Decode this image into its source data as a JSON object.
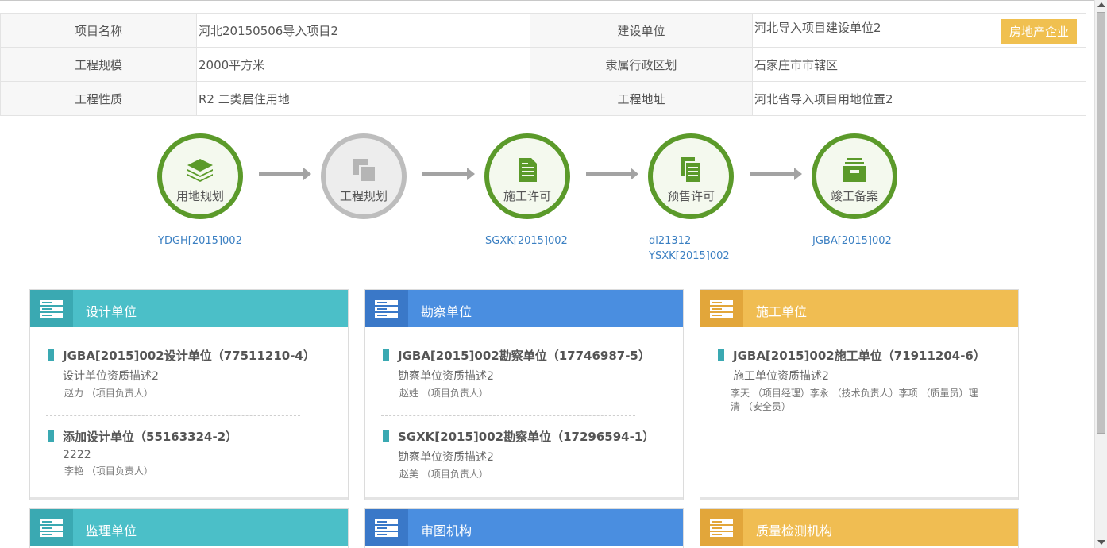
{
  "info": {
    "rows": [
      {
        "l1": "项目名称",
        "v1": "河北20150506导入项目2",
        "l2": "建设单位",
        "v2": "河北导入项目建设单位2"
      },
      {
        "l1": "工程规模",
        "v1": "2000平方米",
        "l2": "隶属行政区划",
        "v2": "石家庄市市辖区"
      },
      {
        "l1": "工程性质",
        "v1": "R2 二类居住用地",
        "l2": "工程地址",
        "v2": "河北省导入项目用地位置2"
      }
    ],
    "tag": "房地产企业"
  },
  "stages": [
    {
      "name": "用地规划",
      "icon": "layers-icon",
      "active": true,
      "codes": [
        "YDGH[2015]002"
      ]
    },
    {
      "name": "工程规划",
      "icon": "copy-icon",
      "active": false,
      "codes": []
    },
    {
      "name": "施工许可",
      "icon": "document-icon",
      "active": true,
      "codes": [
        "SGXK[2015]002"
      ]
    },
    {
      "name": "预售许可",
      "icon": "documents-icon",
      "active": true,
      "codes": [
        "dl21312",
        "YSXK[2015]002"
      ]
    },
    {
      "name": "竣工备案",
      "icon": "archive-icon",
      "active": true,
      "codes": [
        "JGBA[2015]002"
      ]
    }
  ],
  "cards": [
    {
      "title": "设计单位",
      "color": "teal",
      "entries": [
        {
          "title": "JGBA[2015]002设计单位（77511210-4）",
          "desc": "设计单位资质描述2",
          "people": "赵力 （项目负责人）"
        },
        {
          "title": "添加设计单位（55163324-2）",
          "desc": "2222",
          "people": "李艳 （项目负责人）"
        }
      ]
    },
    {
      "title": "勘察单位",
      "color": "blue",
      "entries": [
        {
          "title": "JGBA[2015]002勘察单位（17746987-5）",
          "desc": "勘察单位资质描述2",
          "people": "赵姓 （项目负责人）"
        },
        {
          "title": "SGXK[2015]002勘察单位（17296594-1）",
          "desc": "勘察单位资质描述2",
          "people": "赵美 （项目负责人）"
        }
      ]
    },
    {
      "title": "施工单位",
      "color": "yellow",
      "entries": [
        {
          "title": "JGBA[2015]002施工单位（71911204-6）",
          "desc": "施工单位资质描述2",
          "people": "李天 （项目经理）李永 （技术负责人）李项 （质量员）理清 （安全员）"
        }
      ]
    },
    {
      "title": "监理单位",
      "color": "teal",
      "entries": []
    },
    {
      "title": "审图机构",
      "color": "blue",
      "entries": []
    },
    {
      "title": "质量检测机构",
      "color": "yellow",
      "entries": []
    }
  ],
  "colors": {
    "green": "#5b9a2a",
    "gray": "#bdbdbd",
    "teal": "#4bbfc8",
    "blue": "#4a8ee0",
    "yellow": "#f0bd52",
    "link": "#3a7fc2"
  }
}
